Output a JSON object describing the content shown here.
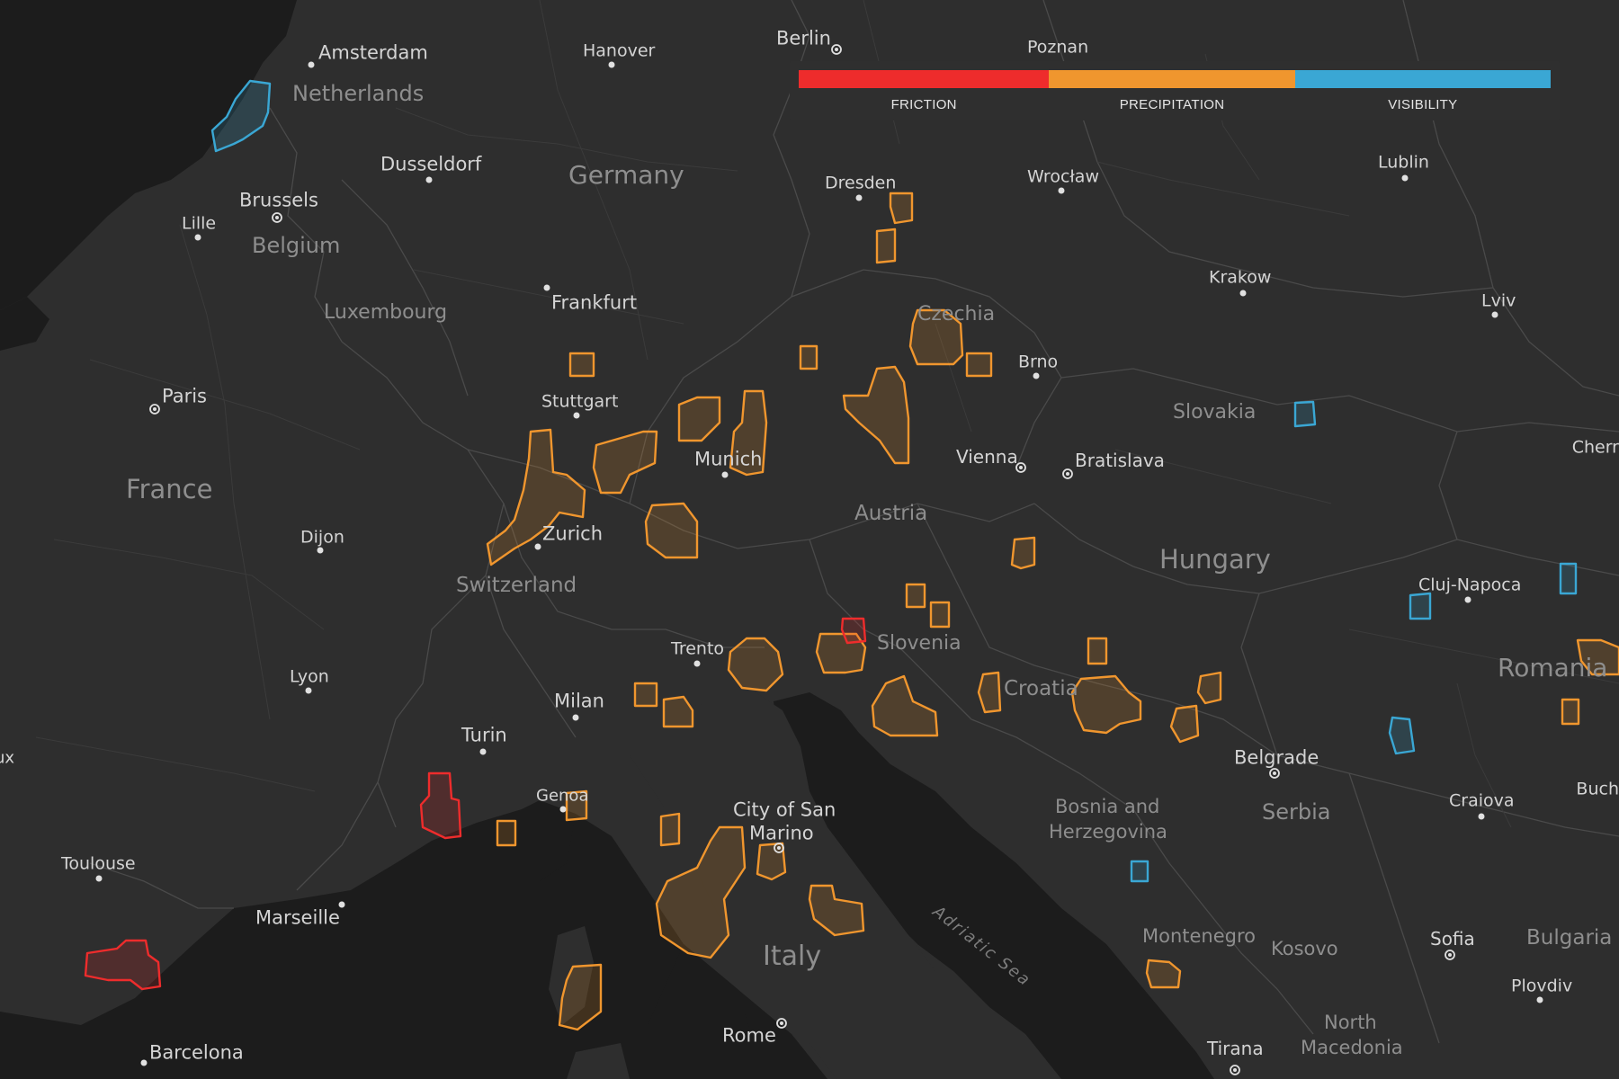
{
  "legend": {
    "items": [
      {
        "label": "FRICTION",
        "color": "#ee2c2c"
      },
      {
        "label": "PRECIPITATION",
        "color": "#f0962e"
      },
      {
        "label": "VISIBILITY",
        "color": "#3aa7d4"
      }
    ]
  },
  "colors": {
    "land": "#2e2e2e",
    "water": "#1c1c1c",
    "border": "#4a4a4a",
    "friction": "#ee2c2c",
    "precipitation": "#f0962e",
    "visibility": "#3aa7d4"
  },
  "cities": [
    {
      "name": "Amsterdam"
    },
    {
      "name": "Hanover"
    },
    {
      "name": "Berlin"
    },
    {
      "name": "Poznan"
    },
    {
      "name": "Dusseldorf"
    },
    {
      "name": "Brussels"
    },
    {
      "name": "Lille"
    },
    {
      "name": "Dresden"
    },
    {
      "name": "Wrocław"
    },
    {
      "name": "Lublin"
    },
    {
      "name": "Frankfurt"
    },
    {
      "name": "Krakow"
    },
    {
      "name": "Lviv"
    },
    {
      "name": "Paris"
    },
    {
      "name": "Stuttgart"
    },
    {
      "name": "Brno"
    },
    {
      "name": "Munich"
    },
    {
      "name": "Vienna"
    },
    {
      "name": "Bratislava"
    },
    {
      "name": "Zurich"
    },
    {
      "name": "Dijon"
    },
    {
      "name": "Cluj-Napoca"
    },
    {
      "name": "Trento"
    },
    {
      "name": "Lyon"
    },
    {
      "name": "Milan"
    },
    {
      "name": "Turin"
    },
    {
      "name": "Genoa"
    },
    {
      "name": "City of San"
    },
    {
      "name": "Marino"
    },
    {
      "name": "Belgrade"
    },
    {
      "name": "Craiova"
    },
    {
      "name": "Toulouse"
    },
    {
      "name": "Marseille"
    },
    {
      "name": "Sofia"
    },
    {
      "name": "Plovdiv"
    },
    {
      "name": "Rome"
    },
    {
      "name": "Barcelona"
    },
    {
      "name": "Tirana"
    },
    {
      "name": "Cherr"
    },
    {
      "name": "Buch"
    },
    {
      "name": "ux"
    }
  ],
  "countries": [
    {
      "name": "Netherlands"
    },
    {
      "name": "Germany"
    },
    {
      "name": "Belgium"
    },
    {
      "name": "Luxembourg"
    },
    {
      "name": "Czechia"
    },
    {
      "name": "Slovakia"
    },
    {
      "name": "France"
    },
    {
      "name": "Austria"
    },
    {
      "name": "Hungary"
    },
    {
      "name": "Switzerland"
    },
    {
      "name": "Slovenia"
    },
    {
      "name": "Romania"
    },
    {
      "name": "Croatia"
    },
    {
      "name": "Bosnia and"
    },
    {
      "name": "Herzegovina"
    },
    {
      "name": "Serbia"
    },
    {
      "name": "Montenegro"
    },
    {
      "name": "Kosovo"
    },
    {
      "name": "Bulgaria"
    },
    {
      "name": "Italy"
    },
    {
      "name": "North"
    },
    {
      "name": "Macedonia"
    }
  ],
  "seas": [
    {
      "name": "Adriatic Sea"
    }
  ]
}
